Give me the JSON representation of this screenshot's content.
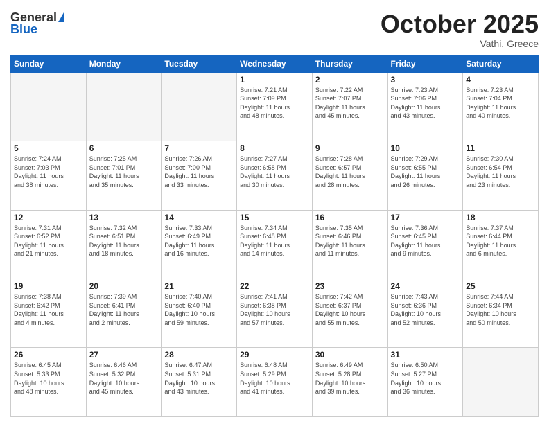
{
  "logo": {
    "general": "General",
    "blue": "Blue"
  },
  "header": {
    "month": "October 2025",
    "location": "Vathi, Greece"
  },
  "days_of_week": [
    "Sunday",
    "Monday",
    "Tuesday",
    "Wednesday",
    "Thursday",
    "Friday",
    "Saturday"
  ],
  "weeks": [
    [
      {
        "day": "",
        "info": ""
      },
      {
        "day": "",
        "info": ""
      },
      {
        "day": "",
        "info": ""
      },
      {
        "day": "1",
        "info": "Sunrise: 7:21 AM\nSunset: 7:09 PM\nDaylight: 11 hours\nand 48 minutes."
      },
      {
        "day": "2",
        "info": "Sunrise: 7:22 AM\nSunset: 7:07 PM\nDaylight: 11 hours\nand 45 minutes."
      },
      {
        "day": "3",
        "info": "Sunrise: 7:23 AM\nSunset: 7:06 PM\nDaylight: 11 hours\nand 43 minutes."
      },
      {
        "day": "4",
        "info": "Sunrise: 7:23 AM\nSunset: 7:04 PM\nDaylight: 11 hours\nand 40 minutes."
      }
    ],
    [
      {
        "day": "5",
        "info": "Sunrise: 7:24 AM\nSunset: 7:03 PM\nDaylight: 11 hours\nand 38 minutes."
      },
      {
        "day": "6",
        "info": "Sunrise: 7:25 AM\nSunset: 7:01 PM\nDaylight: 11 hours\nand 35 minutes."
      },
      {
        "day": "7",
        "info": "Sunrise: 7:26 AM\nSunset: 7:00 PM\nDaylight: 11 hours\nand 33 minutes."
      },
      {
        "day": "8",
        "info": "Sunrise: 7:27 AM\nSunset: 6:58 PM\nDaylight: 11 hours\nand 30 minutes."
      },
      {
        "day": "9",
        "info": "Sunrise: 7:28 AM\nSunset: 6:57 PM\nDaylight: 11 hours\nand 28 minutes."
      },
      {
        "day": "10",
        "info": "Sunrise: 7:29 AM\nSunset: 6:55 PM\nDaylight: 11 hours\nand 26 minutes."
      },
      {
        "day": "11",
        "info": "Sunrise: 7:30 AM\nSunset: 6:54 PM\nDaylight: 11 hours\nand 23 minutes."
      }
    ],
    [
      {
        "day": "12",
        "info": "Sunrise: 7:31 AM\nSunset: 6:52 PM\nDaylight: 11 hours\nand 21 minutes."
      },
      {
        "day": "13",
        "info": "Sunrise: 7:32 AM\nSunset: 6:51 PM\nDaylight: 11 hours\nand 18 minutes."
      },
      {
        "day": "14",
        "info": "Sunrise: 7:33 AM\nSunset: 6:49 PM\nDaylight: 11 hours\nand 16 minutes."
      },
      {
        "day": "15",
        "info": "Sunrise: 7:34 AM\nSunset: 6:48 PM\nDaylight: 11 hours\nand 14 minutes."
      },
      {
        "day": "16",
        "info": "Sunrise: 7:35 AM\nSunset: 6:46 PM\nDaylight: 11 hours\nand 11 minutes."
      },
      {
        "day": "17",
        "info": "Sunrise: 7:36 AM\nSunset: 6:45 PM\nDaylight: 11 hours\nand 9 minutes."
      },
      {
        "day": "18",
        "info": "Sunrise: 7:37 AM\nSunset: 6:44 PM\nDaylight: 11 hours\nand 6 minutes."
      }
    ],
    [
      {
        "day": "19",
        "info": "Sunrise: 7:38 AM\nSunset: 6:42 PM\nDaylight: 11 hours\nand 4 minutes."
      },
      {
        "day": "20",
        "info": "Sunrise: 7:39 AM\nSunset: 6:41 PM\nDaylight: 11 hours\nand 2 minutes."
      },
      {
        "day": "21",
        "info": "Sunrise: 7:40 AM\nSunset: 6:40 PM\nDaylight: 10 hours\nand 59 minutes."
      },
      {
        "day": "22",
        "info": "Sunrise: 7:41 AM\nSunset: 6:38 PM\nDaylight: 10 hours\nand 57 minutes."
      },
      {
        "day": "23",
        "info": "Sunrise: 7:42 AM\nSunset: 6:37 PM\nDaylight: 10 hours\nand 55 minutes."
      },
      {
        "day": "24",
        "info": "Sunrise: 7:43 AM\nSunset: 6:36 PM\nDaylight: 10 hours\nand 52 minutes."
      },
      {
        "day": "25",
        "info": "Sunrise: 7:44 AM\nSunset: 6:34 PM\nDaylight: 10 hours\nand 50 minutes."
      }
    ],
    [
      {
        "day": "26",
        "info": "Sunrise: 6:45 AM\nSunset: 5:33 PM\nDaylight: 10 hours\nand 48 minutes."
      },
      {
        "day": "27",
        "info": "Sunrise: 6:46 AM\nSunset: 5:32 PM\nDaylight: 10 hours\nand 45 minutes."
      },
      {
        "day": "28",
        "info": "Sunrise: 6:47 AM\nSunset: 5:31 PM\nDaylight: 10 hours\nand 43 minutes."
      },
      {
        "day": "29",
        "info": "Sunrise: 6:48 AM\nSunset: 5:29 PM\nDaylight: 10 hours\nand 41 minutes."
      },
      {
        "day": "30",
        "info": "Sunrise: 6:49 AM\nSunset: 5:28 PM\nDaylight: 10 hours\nand 39 minutes."
      },
      {
        "day": "31",
        "info": "Sunrise: 6:50 AM\nSunset: 5:27 PM\nDaylight: 10 hours\nand 36 minutes."
      },
      {
        "day": "",
        "info": ""
      }
    ]
  ]
}
